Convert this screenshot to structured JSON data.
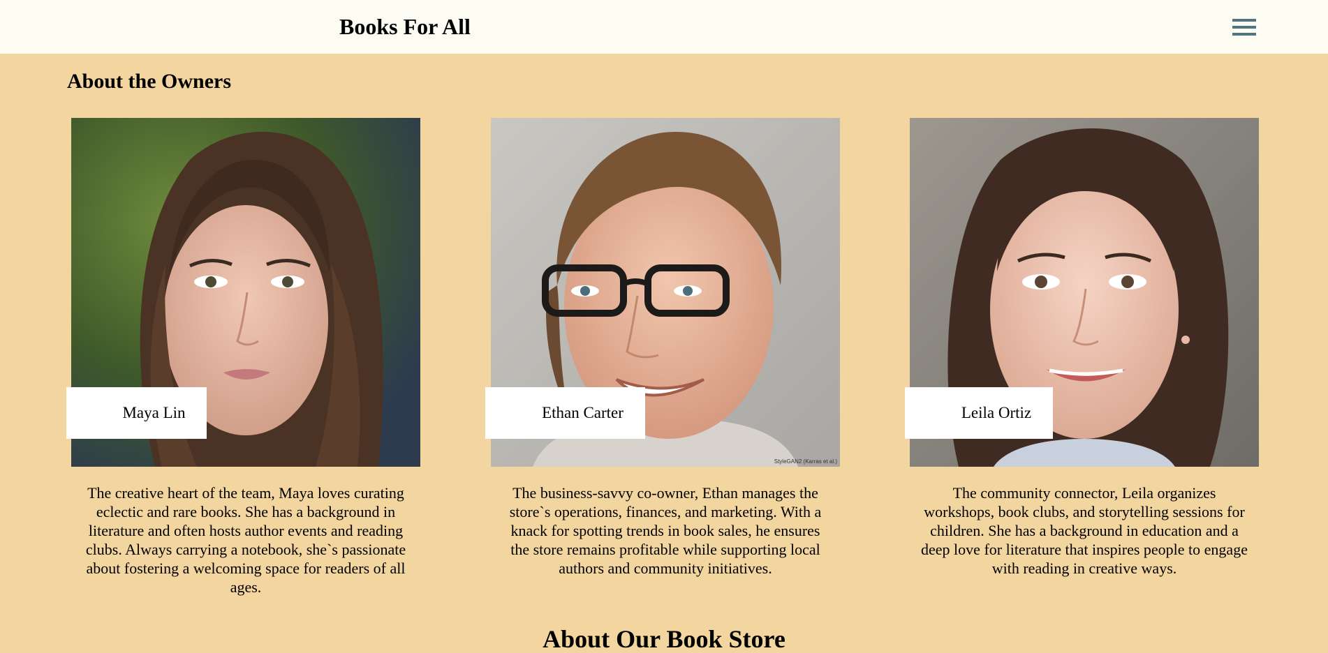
{
  "header": {
    "brand": "Books For All",
    "menu_icon": "hamburger-menu-icon"
  },
  "main": {
    "section_title": "About the Owners",
    "owners": [
      {
        "name": "Maya Lin",
        "bio": "The creative heart of the team, Maya loves curating eclectic and rare books. She has a background in literature and often hosts author events and reading clubs. Always carrying a notebook, she`s passionate about fostering a welcoming space for readers of all ages."
      },
      {
        "name": "Ethan Carter",
        "bio": "The business-savvy co-owner, Ethan manages the store`s operations, finances, and marketing. With a knack for spotting trends in book sales, he ensures the store remains profitable while supporting local authors and community initiatives.",
        "photo_credit": "StyleGAN2 (Karras et al.)"
      },
      {
        "name": "Leila Ortiz",
        "bio": "The community connector, Leila organizes workshops, book clubs, and storytelling sessions for children. She has a background in education and a deep love for literature that inspires people to engage with reading in creative ways."
      }
    ],
    "next_section_title": "About Our Book Store"
  },
  "colors": {
    "page_background": "#f2d59f",
    "header_background": "#fdfcf3",
    "menu_icon": "#4f7582",
    "name_tag_background": "#ffffff"
  }
}
